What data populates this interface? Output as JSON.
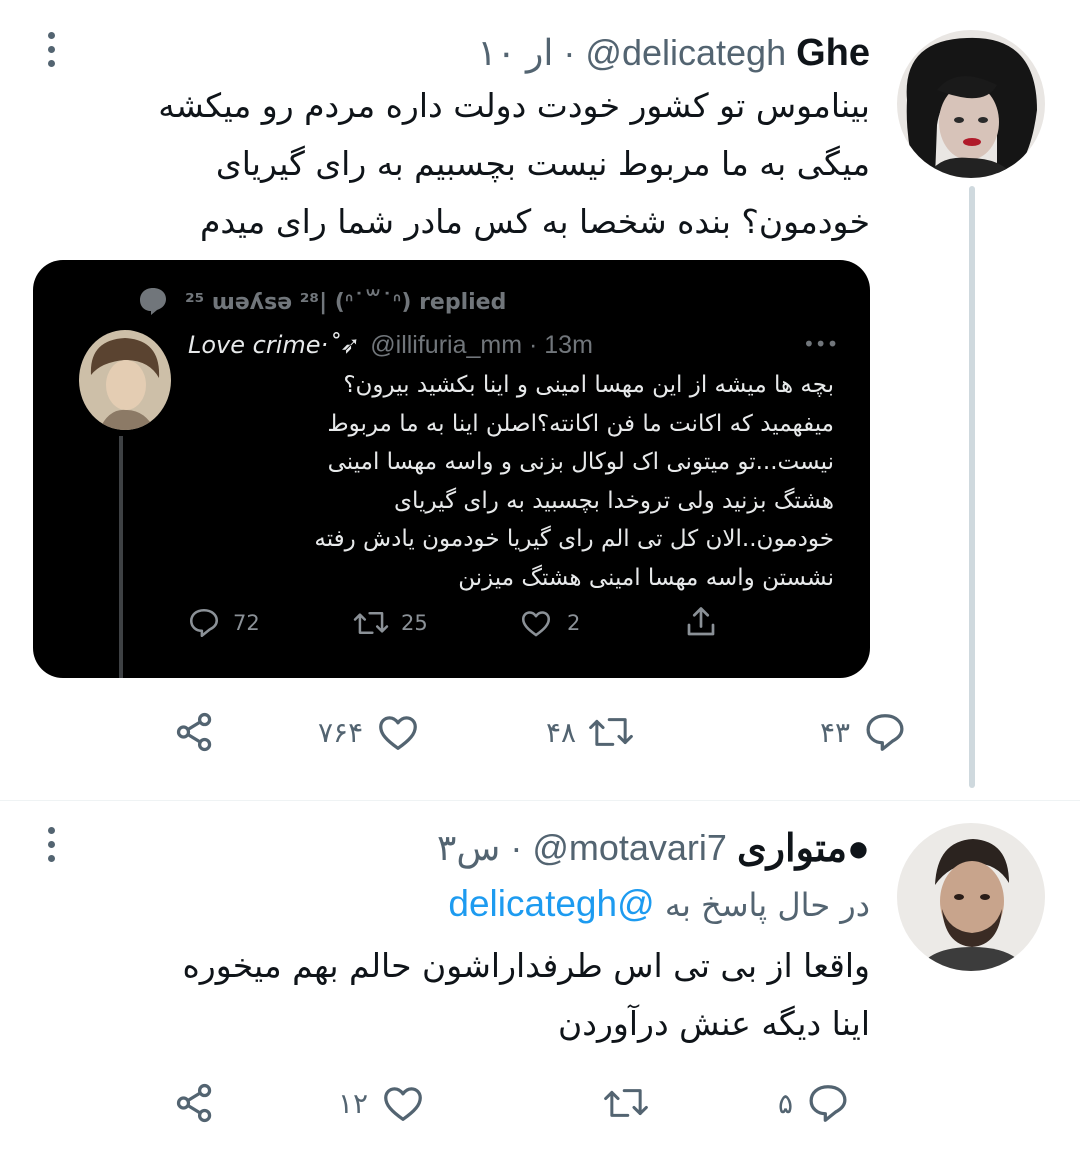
{
  "tweet1": {
    "name": "Ghe",
    "handle": "@delicategh",
    "separator": "·",
    "time": "۱۰ ار",
    "text_lines": [
      "بیناموس تو کشور خودت دولت داره مردم رو میکشه",
      "میگی به ما مربوط نیست بچسبیم به رای گیریای",
      "خودمون؟ بنده شخصا به کس مادر شما رای میدم"
    ],
    "embedded": {
      "replied_label": "²⁵ ɯǝʎsǝ ²⁸| (ᐢ˙꒳˙ᐢ) replied",
      "name": "Love crime·˚➶",
      "handle": "@illifuria_mm · 13m",
      "more": "•••",
      "text_lines": [
        "بچه ها میشه از این مهسا امینی و اینا بکشید بیرون؟",
        "میفهمید که اکانت ما فن اکانته؟اصلن اینا به ما مربوط",
        "نیست...تو میتونی اک لوکال بزنی و واسه مهسا امینی",
        "هشتگ بزنید ولی تروخدا بچسبید به رای گیریای",
        "خودمون..الان کل تی الم رای گیریا خودمون یادش رفته",
        "نشستن واسه مهسا امینی هشتگ میزنن"
      ],
      "replies": "72",
      "retweets": "25",
      "likes": "2"
    },
    "actions": {
      "replies": "۴۳",
      "retweets": "۴۸",
      "likes": "۷۶۴"
    }
  },
  "tweet2": {
    "name": "متواری●",
    "handle": "@motavari7",
    "separator": "·",
    "time": "۳س",
    "reply_to_prefix": "در حال پاسخ به",
    "reply_to_handle": "@delicategh",
    "text_lines": [
      "واقعا از بی تی اس طرفداراشون حالم بهم میخوره",
      "اینا دیگه عنش درآوردن"
    ],
    "actions": {
      "replies": "۵",
      "retweets": "",
      "likes": "۱۲"
    }
  },
  "colors": {
    "text": "#0f1419",
    "secondary": "#536471",
    "link": "#1d9bf0",
    "thread_line": "#cfd9de",
    "card_bg": "#000000"
  },
  "icons": [
    "more-vertical-icon",
    "reply-icon",
    "retweet-icon",
    "like-icon",
    "share-icon",
    "chat-bubble-icon",
    "upload-icon"
  ]
}
